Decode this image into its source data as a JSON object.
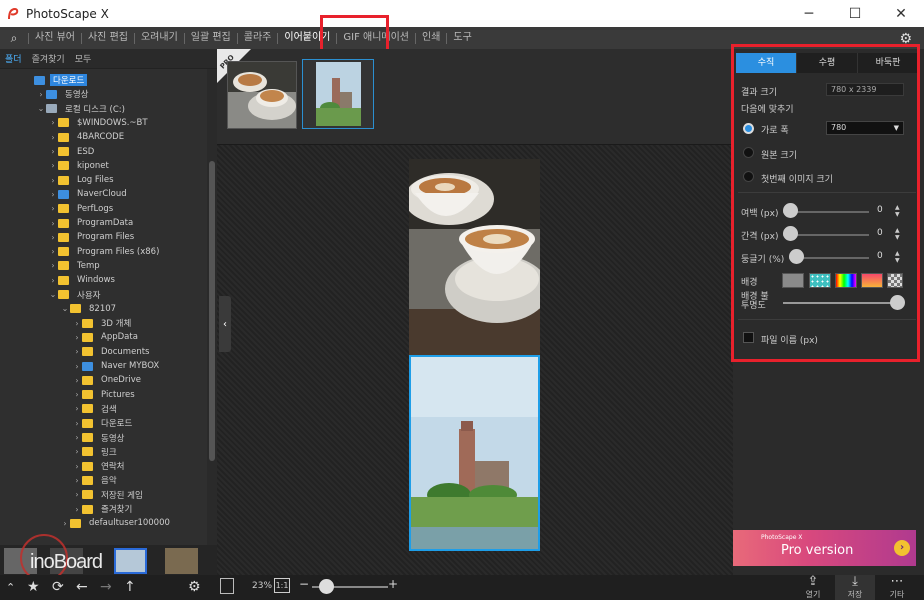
{
  "window": {
    "title": "PhotoScape X",
    "min_icon": "─",
    "max_icon": "☐",
    "close_icon": "✕"
  },
  "menu": {
    "search_icon": "⌕",
    "items": [
      "사진 뷰어",
      "사진 편집",
      "오려내기",
      "일괄 편집",
      "콜라주",
      "이어붙이기",
      "GIF 애니메이션",
      "인쇄",
      "도구"
    ],
    "active": "이어붙이기",
    "gear_icon": "⚙"
  },
  "left_panel": {
    "tabs": [
      "폴더",
      "즐겨찾기",
      "모두"
    ],
    "active_tab": "폴더",
    "tree": [
      {
        "label": "다운로드",
        "depth": 0,
        "arrow": "",
        "type": "blue",
        "selected": true
      },
      {
        "label": "동영상",
        "depth": 1,
        "arrow": "›",
        "type": "blue"
      },
      {
        "label": "로컬 디스크 (C:)",
        "depth": 1,
        "arrow": "⌄",
        "type": "drive"
      },
      {
        "label": "$WINDOWS.~BT",
        "depth": 2,
        "arrow": "›",
        "type": "folder"
      },
      {
        "label": "4BARCODE",
        "depth": 2,
        "arrow": "›",
        "type": "folder"
      },
      {
        "label": "ESD",
        "depth": 2,
        "arrow": "›",
        "type": "folder"
      },
      {
        "label": "kiponet",
        "depth": 2,
        "arrow": "›",
        "type": "folder"
      },
      {
        "label": "Log Files",
        "depth": 2,
        "arrow": "›",
        "type": "folder"
      },
      {
        "label": "NaverCloud",
        "depth": 2,
        "arrow": "›",
        "type": "blue"
      },
      {
        "label": "PerfLogs",
        "depth": 2,
        "arrow": "›",
        "type": "folder"
      },
      {
        "label": "ProgramData",
        "depth": 2,
        "arrow": "›",
        "type": "folder"
      },
      {
        "label": "Program Files",
        "depth": 2,
        "arrow": "›",
        "type": "folder"
      },
      {
        "label": "Program Files (x86)",
        "depth": 2,
        "arrow": "›",
        "type": "folder"
      },
      {
        "label": "Temp",
        "depth": 2,
        "arrow": "›",
        "type": "folder"
      },
      {
        "label": "Windows",
        "depth": 2,
        "arrow": "›",
        "type": "folder"
      },
      {
        "label": "사용자",
        "depth": 2,
        "arrow": "⌄",
        "type": "folder"
      },
      {
        "label": "82107",
        "depth": 3,
        "arrow": "⌄",
        "type": "folder"
      },
      {
        "label": "3D 개체",
        "depth": 4,
        "arrow": "›",
        "type": "folder"
      },
      {
        "label": "AppData",
        "depth": 4,
        "arrow": "›",
        "type": "folder"
      },
      {
        "label": "Documents",
        "depth": 4,
        "arrow": "›",
        "type": "folder"
      },
      {
        "label": "Naver MYBOX",
        "depth": 4,
        "arrow": "›",
        "type": "blue"
      },
      {
        "label": "OneDrive",
        "depth": 4,
        "arrow": "›",
        "type": "folder"
      },
      {
        "label": "Pictures",
        "depth": 4,
        "arrow": "›",
        "type": "folder"
      },
      {
        "label": "검색",
        "depth": 4,
        "arrow": "›",
        "type": "folder"
      },
      {
        "label": "다운로드",
        "depth": 4,
        "arrow": "›",
        "type": "folder"
      },
      {
        "label": "동영상",
        "depth": 4,
        "arrow": "›",
        "type": "folder"
      },
      {
        "label": "링크",
        "depth": 4,
        "arrow": "›",
        "type": "folder"
      },
      {
        "label": "연락처",
        "depth": 4,
        "arrow": "›",
        "type": "folder"
      },
      {
        "label": "음악",
        "depth": 4,
        "arrow": "›",
        "type": "folder"
      },
      {
        "label": "저장된 게임",
        "depth": 4,
        "arrow": "›",
        "type": "folder"
      },
      {
        "label": "즐겨찾기",
        "depth": 4,
        "arrow": "›",
        "type": "folder"
      },
      {
        "label": "defaultuser100000",
        "depth": 3,
        "arrow": "›",
        "type": "folder"
      }
    ]
  },
  "watermark": "inoBoard",
  "thumb_strip": {
    "pro_badge": "PRO"
  },
  "bottom_toolbar": {
    "zoom": "23%",
    "one_to_one": "1:1",
    "minus": "−",
    "plus": "+",
    "zoom_fraction": 0.1,
    "nav_icons": [
      "⌃",
      "★",
      "⟳",
      "←",
      "→",
      "↑"
    ],
    "gear_icon": "⚙",
    "actions": [
      {
        "label": "열기",
        "icon": "⇪"
      },
      {
        "label": "저장",
        "icon": "⤓"
      },
      {
        "label": "기타",
        "icon": "⋯"
      }
    ]
  },
  "collapse_arrow": "‹",
  "right_panel": {
    "tabs": [
      "수직",
      "수평",
      "바둑판"
    ],
    "active_tab": "수직",
    "result_size_label": "결과 크기",
    "result_size_value": "780 x 2339",
    "fit_label": "다음에 맞추기",
    "fit_options": [
      {
        "label": "가로 폭",
        "checked": true
      },
      {
        "label": "원본 크기",
        "checked": false
      },
      {
        "label": "첫번째 이미지 크기",
        "checked": false
      }
    ],
    "width_select": "780",
    "sliders": [
      {
        "label": "여백 (px)",
        "value": "0"
      },
      {
        "label": "간격 (px)",
        "value": "0"
      },
      {
        "label": "둥글기 (%)",
        "value": "0"
      }
    ],
    "background_label": "배경",
    "opacity_label": "배경 불투명도",
    "filename_label": "파일 이름 (px)",
    "promo_small": "PhotoScape X",
    "promo_big": "Pro version",
    "promo_arrow": "›",
    "colors": {
      "accent": "#2b8fe0",
      "highlight": "#e8212c"
    }
  }
}
